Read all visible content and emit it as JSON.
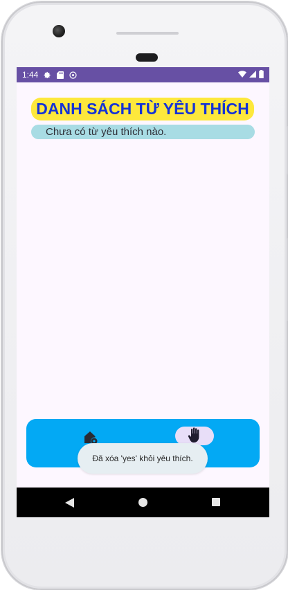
{
  "status_bar": {
    "time": "1:44",
    "left_icons": [
      "settings-icon",
      "sd-card-icon",
      "sync-icon"
    ],
    "right_icons": [
      "wifi-icon",
      "cell-signal-icon",
      "battery-icon"
    ]
  },
  "screen": {
    "title": "DANH SÁCH TỪ YÊU THÍCH",
    "empty_message": "Chưa có từ yêu thích nào."
  },
  "bottom_nav": {
    "items": [
      {
        "icon": "home-settings-icon"
      },
      {
        "icon": "hand-icon",
        "selected": true
      }
    ]
  },
  "toast": {
    "message": "Đã xóa 'yes' khỏi yêu thích."
  },
  "system_nav": {
    "buttons": [
      "back-icon",
      "home-circle-icon",
      "recents-square-icon"
    ]
  },
  "colors": {
    "status_bar": "#6750a4",
    "screen_background": "#fdf7ff",
    "title_pill": "#fde83c",
    "title_text": "#1533d6",
    "empty_pill": "#a8dce4",
    "bottom_nav": "#03a9f4",
    "nav_selected_pill": "#e8def8",
    "toast_background": "#e6eef2"
  }
}
